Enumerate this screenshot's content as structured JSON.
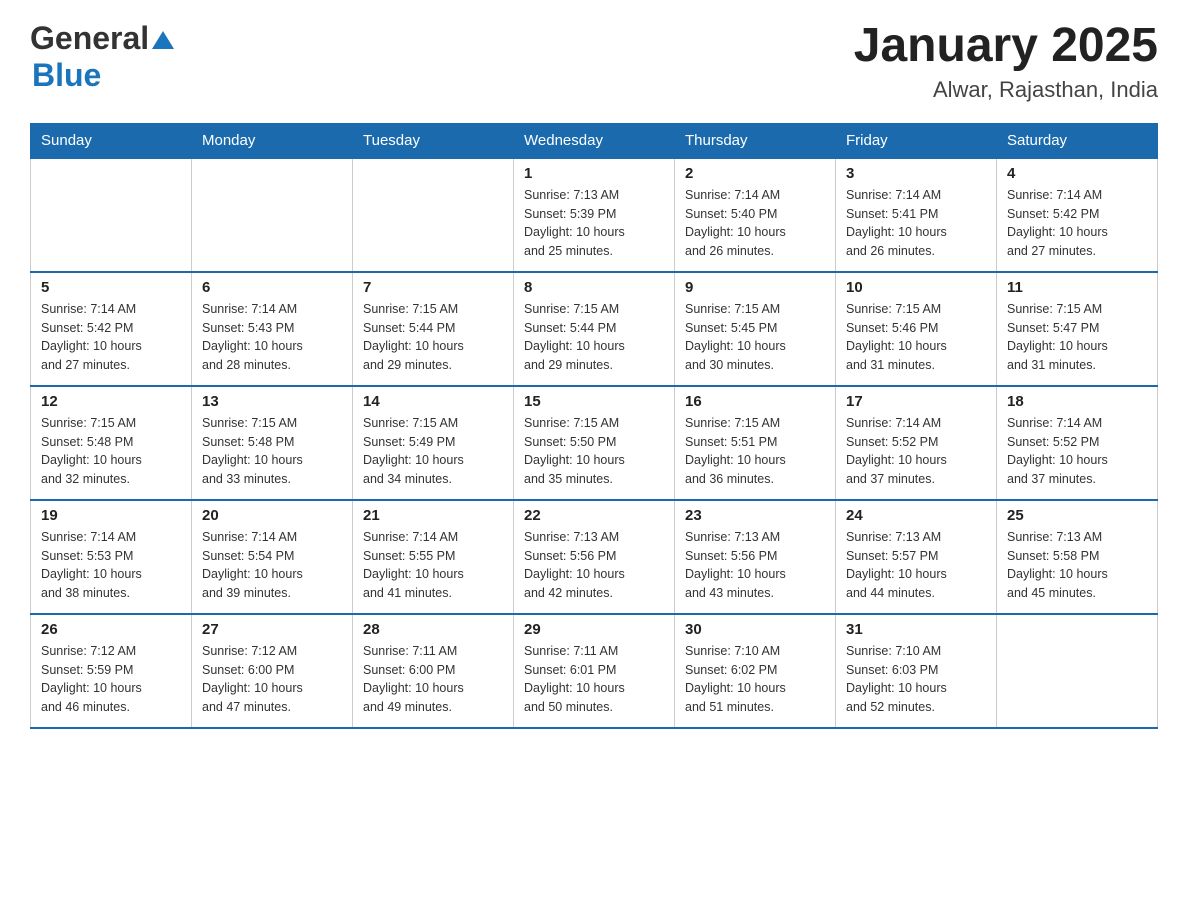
{
  "header": {
    "logo_general": "General",
    "logo_blue": "Blue",
    "month_title": "January 2025",
    "location": "Alwar, Rajasthan, India"
  },
  "days_of_week": [
    "Sunday",
    "Monday",
    "Tuesday",
    "Wednesday",
    "Thursday",
    "Friday",
    "Saturday"
  ],
  "weeks": [
    [
      {
        "day": "",
        "info": ""
      },
      {
        "day": "",
        "info": ""
      },
      {
        "day": "",
        "info": ""
      },
      {
        "day": "1",
        "info": "Sunrise: 7:13 AM\nSunset: 5:39 PM\nDaylight: 10 hours\nand 25 minutes."
      },
      {
        "day": "2",
        "info": "Sunrise: 7:14 AM\nSunset: 5:40 PM\nDaylight: 10 hours\nand 26 minutes."
      },
      {
        "day": "3",
        "info": "Sunrise: 7:14 AM\nSunset: 5:41 PM\nDaylight: 10 hours\nand 26 minutes."
      },
      {
        "day": "4",
        "info": "Sunrise: 7:14 AM\nSunset: 5:42 PM\nDaylight: 10 hours\nand 27 minutes."
      }
    ],
    [
      {
        "day": "5",
        "info": "Sunrise: 7:14 AM\nSunset: 5:42 PM\nDaylight: 10 hours\nand 27 minutes."
      },
      {
        "day": "6",
        "info": "Sunrise: 7:14 AM\nSunset: 5:43 PM\nDaylight: 10 hours\nand 28 minutes."
      },
      {
        "day": "7",
        "info": "Sunrise: 7:15 AM\nSunset: 5:44 PM\nDaylight: 10 hours\nand 29 minutes."
      },
      {
        "day": "8",
        "info": "Sunrise: 7:15 AM\nSunset: 5:44 PM\nDaylight: 10 hours\nand 29 minutes."
      },
      {
        "day": "9",
        "info": "Sunrise: 7:15 AM\nSunset: 5:45 PM\nDaylight: 10 hours\nand 30 minutes."
      },
      {
        "day": "10",
        "info": "Sunrise: 7:15 AM\nSunset: 5:46 PM\nDaylight: 10 hours\nand 31 minutes."
      },
      {
        "day": "11",
        "info": "Sunrise: 7:15 AM\nSunset: 5:47 PM\nDaylight: 10 hours\nand 31 minutes."
      }
    ],
    [
      {
        "day": "12",
        "info": "Sunrise: 7:15 AM\nSunset: 5:48 PM\nDaylight: 10 hours\nand 32 minutes."
      },
      {
        "day": "13",
        "info": "Sunrise: 7:15 AM\nSunset: 5:48 PM\nDaylight: 10 hours\nand 33 minutes."
      },
      {
        "day": "14",
        "info": "Sunrise: 7:15 AM\nSunset: 5:49 PM\nDaylight: 10 hours\nand 34 minutes."
      },
      {
        "day": "15",
        "info": "Sunrise: 7:15 AM\nSunset: 5:50 PM\nDaylight: 10 hours\nand 35 minutes."
      },
      {
        "day": "16",
        "info": "Sunrise: 7:15 AM\nSunset: 5:51 PM\nDaylight: 10 hours\nand 36 minutes."
      },
      {
        "day": "17",
        "info": "Sunrise: 7:14 AM\nSunset: 5:52 PM\nDaylight: 10 hours\nand 37 minutes."
      },
      {
        "day": "18",
        "info": "Sunrise: 7:14 AM\nSunset: 5:52 PM\nDaylight: 10 hours\nand 37 minutes."
      }
    ],
    [
      {
        "day": "19",
        "info": "Sunrise: 7:14 AM\nSunset: 5:53 PM\nDaylight: 10 hours\nand 38 minutes."
      },
      {
        "day": "20",
        "info": "Sunrise: 7:14 AM\nSunset: 5:54 PM\nDaylight: 10 hours\nand 39 minutes."
      },
      {
        "day": "21",
        "info": "Sunrise: 7:14 AM\nSunset: 5:55 PM\nDaylight: 10 hours\nand 41 minutes."
      },
      {
        "day": "22",
        "info": "Sunrise: 7:13 AM\nSunset: 5:56 PM\nDaylight: 10 hours\nand 42 minutes."
      },
      {
        "day": "23",
        "info": "Sunrise: 7:13 AM\nSunset: 5:56 PM\nDaylight: 10 hours\nand 43 minutes."
      },
      {
        "day": "24",
        "info": "Sunrise: 7:13 AM\nSunset: 5:57 PM\nDaylight: 10 hours\nand 44 minutes."
      },
      {
        "day": "25",
        "info": "Sunrise: 7:13 AM\nSunset: 5:58 PM\nDaylight: 10 hours\nand 45 minutes."
      }
    ],
    [
      {
        "day": "26",
        "info": "Sunrise: 7:12 AM\nSunset: 5:59 PM\nDaylight: 10 hours\nand 46 minutes."
      },
      {
        "day": "27",
        "info": "Sunrise: 7:12 AM\nSunset: 6:00 PM\nDaylight: 10 hours\nand 47 minutes."
      },
      {
        "day": "28",
        "info": "Sunrise: 7:11 AM\nSunset: 6:00 PM\nDaylight: 10 hours\nand 49 minutes."
      },
      {
        "day": "29",
        "info": "Sunrise: 7:11 AM\nSunset: 6:01 PM\nDaylight: 10 hours\nand 50 minutes."
      },
      {
        "day": "30",
        "info": "Sunrise: 7:10 AM\nSunset: 6:02 PM\nDaylight: 10 hours\nand 51 minutes."
      },
      {
        "day": "31",
        "info": "Sunrise: 7:10 AM\nSunset: 6:03 PM\nDaylight: 10 hours\nand 52 minutes."
      },
      {
        "day": "",
        "info": ""
      }
    ]
  ]
}
